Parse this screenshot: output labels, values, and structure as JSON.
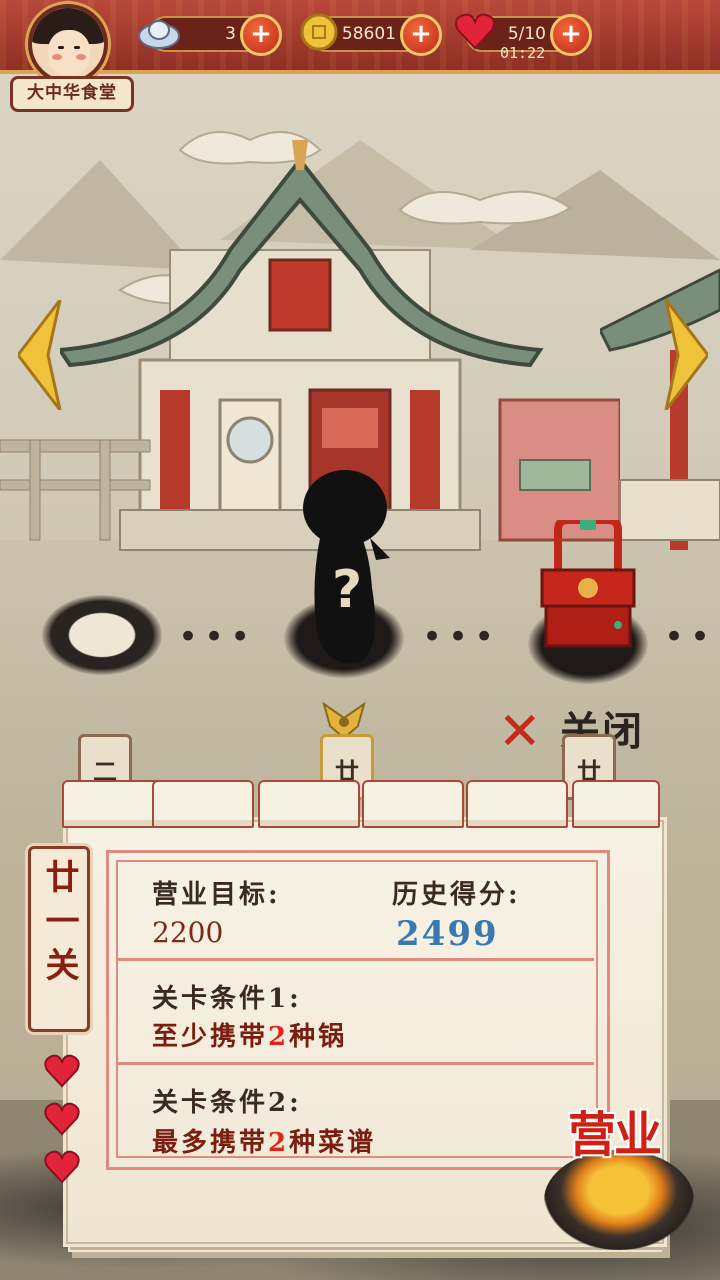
{
  "header": {
    "shop_name": "大中华食堂",
    "silver": "3",
    "gold": "58601",
    "hearts": "5/10",
    "timer": "01:22",
    "plus": "+"
  },
  "stage": {
    "mystery_mark": "?",
    "dots": "•••"
  },
  "close_label": "关闭",
  "tags": [
    "二",
    "廿",
    "廿"
  ],
  "level": {
    "name": "廿一关",
    "target_label": "营业目标:",
    "target_value": "2200",
    "best_label": "历史得分:",
    "best_value": "2499",
    "cond1_label": "关卡条件1:",
    "cond1_prefix": "至少携带",
    "cond1_num": "2",
    "cond1_suffix": "种锅",
    "cond2_label": "关卡条件2:",
    "cond2_prefix": "最多携带",
    "cond2_num": "2",
    "cond2_suffix": "种菜谱"
  },
  "start_button": "营业",
  "colors": {
    "accent": "#c42a1e",
    "highlight": "#3a78b0",
    "panel": "#f7f1e4"
  }
}
